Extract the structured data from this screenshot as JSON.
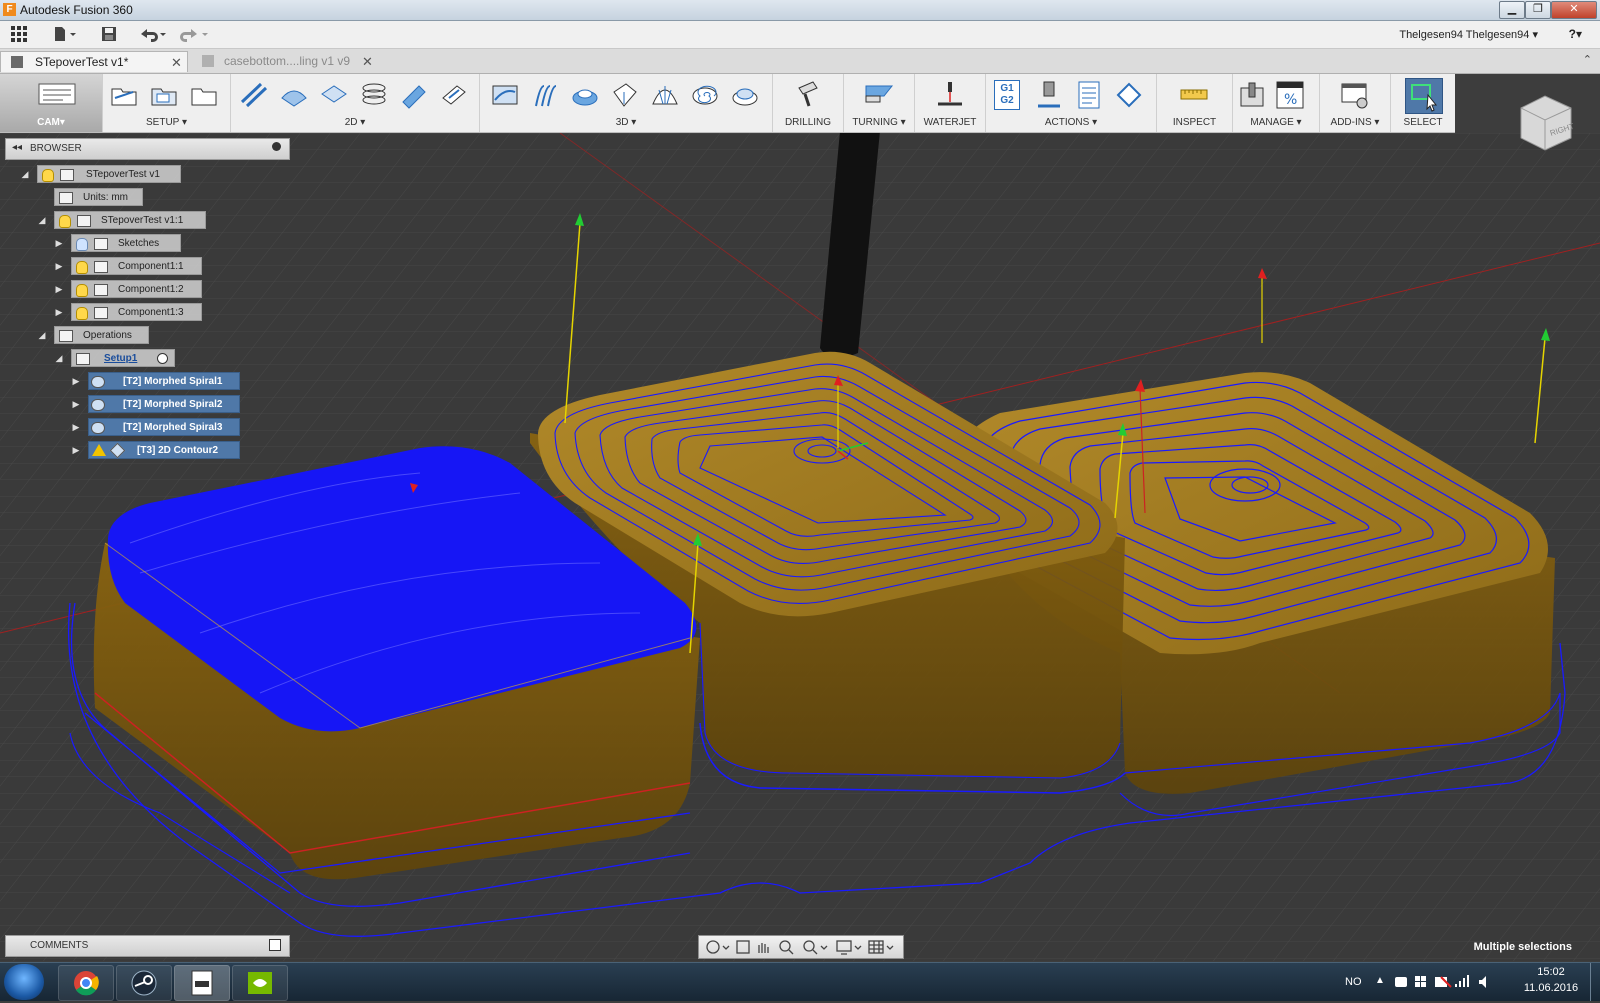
{
  "window": {
    "title": "Autodesk Fusion 360",
    "min": "▁",
    "restore": "❐",
    "close": "✕"
  },
  "appbar": {
    "user": "Thelgesen94 Thelgesen94 ▾",
    "help": "?▾"
  },
  "tabs": [
    {
      "label": "STepoverTest v1*",
      "active": true
    },
    {
      "label": "casebottom....ling v1 v9",
      "active": false
    }
  ],
  "ribbon": {
    "workspace": "CAM▾",
    "groups": [
      "SETUP ▾",
      "2D ▾",
      "3D ▾",
      "DRILLING",
      "TURNING ▾",
      "WATERJET",
      "ACTIONS ▾",
      "INSPECT",
      "MANAGE ▾",
      "ADD-INS ▾",
      "SELECT"
    ],
    "g1g2": "G1\nG2"
  },
  "browser": {
    "title": "BROWSER",
    "tree": [
      {
        "label": "STepoverTest v1"
      },
      {
        "label": "Units: mm"
      },
      {
        "label": "STepoverTest v1:1"
      },
      {
        "label": "Sketches"
      },
      {
        "label": "Component1:1"
      },
      {
        "label": "Component1:2"
      },
      {
        "label": "Component1:3"
      },
      {
        "label": "Operations"
      },
      {
        "label": "Setup1"
      },
      {
        "label": "[T2] Morphed Spiral1"
      },
      {
        "label": "[T2] Morphed Spiral2"
      },
      {
        "label": "[T2] Morphed Spiral3"
      },
      {
        "label": "[T3] 2D Contour2"
      }
    ]
  },
  "viewcube": {
    "right": "RIGHT"
  },
  "comments": {
    "title": "COMMENTS"
  },
  "status": {
    "text": "Multiple selections"
  },
  "tray": {
    "lang": "NO",
    "time": "15:02",
    "date": "11.06.2016"
  },
  "colors": {
    "toolpath": "#1a1aff",
    "stock": "#a07a20",
    "accent": "#4f78a8"
  }
}
